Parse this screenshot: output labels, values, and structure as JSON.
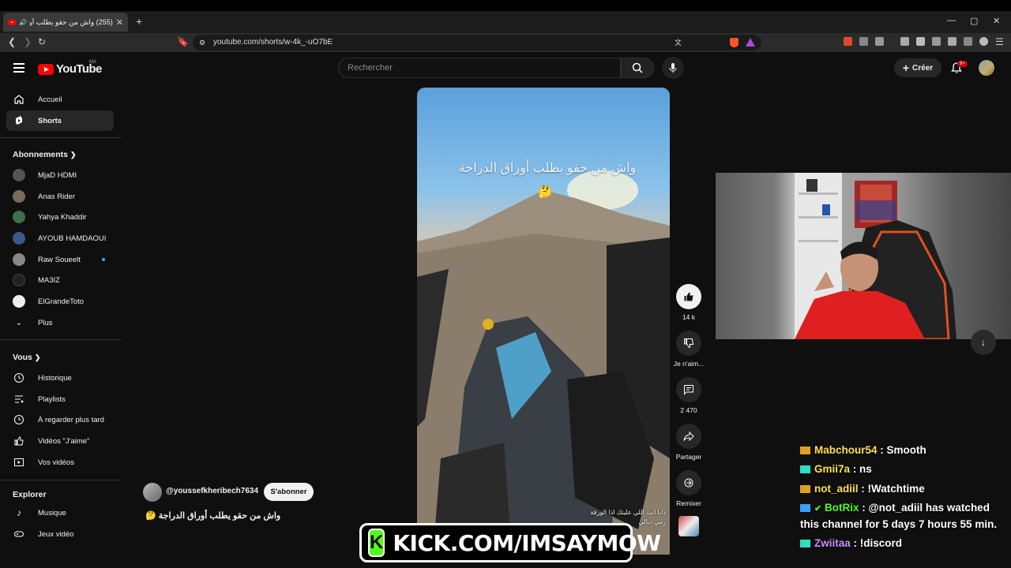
{
  "browser": {
    "tab_title": "(255) واش من حقو يطلب أوراق",
    "new_tab": "+",
    "url": "youtube.com/shorts/w-4k_-uO7bE",
    "win_min": "—",
    "win_max": "▢",
    "win_close": "✕"
  },
  "header": {
    "logo": "YouTube",
    "country": "MA",
    "search_placeholder": "Rechercher",
    "create_label": "Créer",
    "notif_count": "9+"
  },
  "sidebar": {
    "main": [
      {
        "label": "Accueil",
        "icon": "home-icon"
      },
      {
        "label": "Shorts",
        "icon": "shorts-icon"
      }
    ],
    "subscriptions_title": "Abonnements",
    "channels": [
      {
        "label": "MjaD HDMI",
        "color": "#555555"
      },
      {
        "label": "Anas Rider",
        "color": "#7a6a5a"
      },
      {
        "label": "Yahya Khaddir",
        "color": "#3f6f4a"
      },
      {
        "label": "AYOUB HAMDAOUI",
        "color": "#3a5a8a"
      },
      {
        "label": "Raw Soueelt",
        "color": "#888888"
      },
      {
        "label": "MA3IZ",
        "color": "#222222"
      },
      {
        "label": "ElGrandeToto",
        "color": "#eeeeee"
      }
    ],
    "more_label": "Plus",
    "you_title": "Vous",
    "you_items": [
      {
        "label": "Historique",
        "icon": "history-icon"
      },
      {
        "label": "Playlists",
        "icon": "playlists-icon"
      },
      {
        "label": "À regarder plus tard",
        "icon": "watch-later-icon"
      },
      {
        "label": "Vidéos \"J'aime\"",
        "icon": "liked-icon"
      },
      {
        "label": "Vos vidéos",
        "icon": "your-videos-icon"
      }
    ],
    "explore_title": "Explorer",
    "explore_items": [
      {
        "label": "Musique",
        "icon": "music-icon"
      },
      {
        "label": "Jeux vidéo",
        "icon": "gaming-icon"
      }
    ]
  },
  "video": {
    "overlay_text": "واش من حقو يطلب أوراق الدراجة",
    "emoji": "🤔",
    "caption_line1": "دابا انت اللي عليتك اذا الورقة",
    "caption_line2": "رمي ديالي"
  },
  "actions": {
    "like_count": "14 k",
    "dislike_label": "Je n'aim...",
    "comment_count": "2 470",
    "share_label": "Partager",
    "remix_label": "Remixer"
  },
  "channel": {
    "handle": "@youssefkheribech7634",
    "subscribe_label": "S'abonner",
    "description": "واش من حقو يطلب أوراق الدراجة",
    "desc_emoji": "🤔"
  },
  "stream": {
    "chat": [
      {
        "user": "Mabchour54",
        "msg": ": Smooth",
        "color": "#ffe14d",
        "badge": "#e0a020"
      },
      {
        "user": "Gmii7a",
        "msg": ": ns",
        "color": "#ffe14d",
        "badge": "#2ee0c0"
      },
      {
        "user": "not_adiil",
        "msg": ": !Watchtime",
        "color": "#ffe14d",
        "badge": "#e0a020"
      },
      {
        "user": "BotRix",
        "msg": ": @not_adiil has watched",
        "color": "#53fc18",
        "badge": "#3aa0ff"
      },
      {
        "user": "",
        "msg": "this channel for 5 days 7 hours 55 min.",
        "color": "#ffffff",
        "badge": ""
      },
      {
        "user": "Zwiitaa",
        "msg": ": !discord",
        "color": "#c890ff",
        "badge": "#2ee0c0"
      }
    ],
    "kick_logo": "K",
    "kick_url": "KICK.COM/IMSAYMOW"
  }
}
